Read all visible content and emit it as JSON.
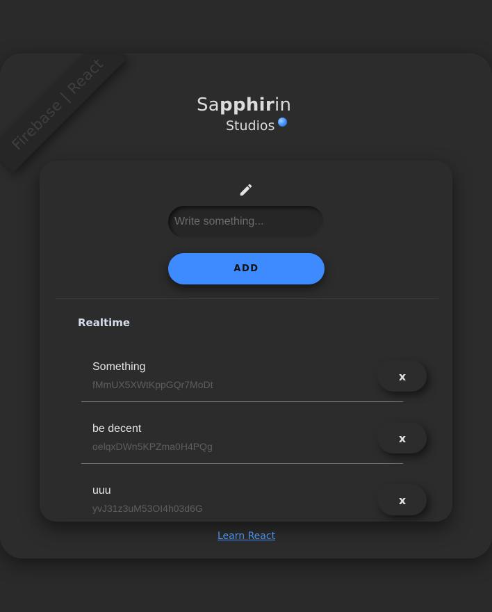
{
  "ribbon": {
    "label": "Firebase | React"
  },
  "brand": {
    "main_pre": "Sa",
    "main_bold1": "pphi",
    "main_bold2": "r",
    "main_post": "in",
    "sub": "Studios"
  },
  "composer": {
    "placeholder": "Write something...",
    "value": "",
    "add_label": "ADD"
  },
  "section": {
    "title": "Realtime"
  },
  "items": [
    {
      "title": "Something",
      "id": "fMmUX5XWtKppGQr7MoDt",
      "delete_label": "x"
    },
    {
      "title": "be decent",
      "id": "oelqxDWn5KPZma0H4PQg",
      "delete_label": "x"
    },
    {
      "title": "uuu",
      "id": "yvJ31z3uM53OI4h03d6G",
      "delete_label": "x"
    }
  ],
  "footer": {
    "link_label": "Learn React"
  },
  "colors": {
    "background": "#2a2a2a",
    "card": "#2c2c2c",
    "accent": "#3d8bff",
    "link": "#4a90e8"
  },
  "icons": {
    "edit": "pencil-icon",
    "brand_dot": "blue-dot-icon"
  }
}
